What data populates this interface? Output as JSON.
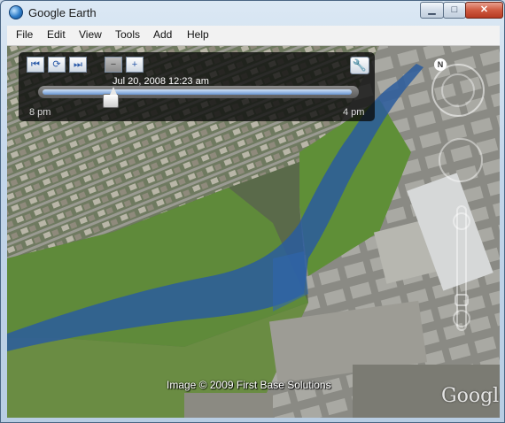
{
  "window": {
    "title": "Google Earth",
    "buttons": {
      "minimize": "▁",
      "maximize": "□",
      "close": "✕"
    }
  },
  "menu": {
    "items": [
      "File",
      "Edit",
      "View",
      "Tools",
      "Add",
      "Help"
    ]
  },
  "time_slider": {
    "date_label": "Jul 20, 2008  12:23 am",
    "range_start": "8 pm",
    "range_end": "4 pm",
    "position_fraction": 0.22,
    "buttons": {
      "back_icon": "skip-back-icon",
      "play_icon": "animate-icon",
      "forward_icon": "skip-forward-icon",
      "zoom_out_icon": "zoom-out-icon",
      "zoom_in_icon": "zoom-in-icon",
      "settings_icon": "wrench-icon"
    }
  },
  "map": {
    "credit": "Image © 2009 First Base Solutions",
    "logo": "Google",
    "river_color": "#2a5c9e"
  },
  "navigation": {
    "north_label": "N"
  }
}
